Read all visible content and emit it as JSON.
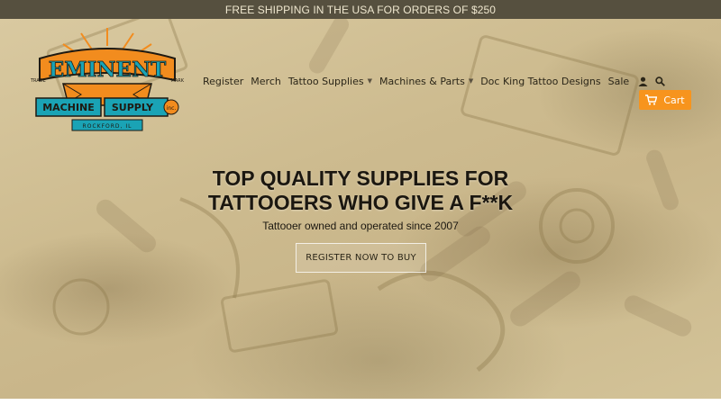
{
  "announcement": {
    "text": "FREE SHIPPING IN THE USA FOR ORDERS OF $250"
  },
  "logo": {
    "brand_top": "EMINENT",
    "brand_left": "MACHINE",
    "brand_right": "SUPPLY",
    "brand_inc": "inc.",
    "location": "ROCKFORD, IL",
    "left_small": "TRADE",
    "right_small": "MARK",
    "colors": {
      "orange": "#f28c1e",
      "teal": "#1aa3b5",
      "ink": "#1f1a12"
    }
  },
  "nav": {
    "register": "Register",
    "merch": "Merch",
    "tattoo_supplies": "Tattoo Supplies",
    "machines_parts": "Machines & Parts",
    "doc_king": "Doc King Tattoo Designs",
    "sale": "Sale",
    "account_icon": "user-icon",
    "search_icon": "search-icon",
    "caret": "▼"
  },
  "cart": {
    "label": "Cart",
    "icon": "cart-icon",
    "color": "#f7941d"
  },
  "hero": {
    "headline_line1": "TOP QUALITY SUPPLIES FOR",
    "headline_line2": "TATTOOERS WHO GIVE A F**K",
    "tagline": "Tattooer owned and operated since 2007",
    "cta": "REGISTER NOW TO BUY"
  },
  "colors": {
    "announce_bg": "#56503f",
    "hero_tint": "#d3c398"
  }
}
